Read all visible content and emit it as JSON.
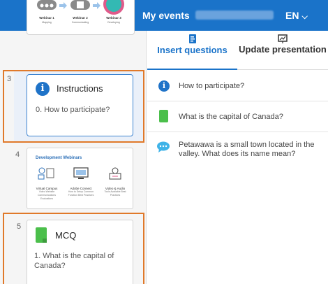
{
  "topbar": {
    "my_events_label": "My events",
    "language_label": "EN"
  },
  "slides": {
    "items": [
      {
        "number": "",
        "webinar_labels": [
          "Webinar 1",
          "Webinar 2",
          "Webinar 3"
        ],
        "webinar_subs": [
          "Mapping",
          "Communicating",
          "Developing"
        ]
      },
      {
        "number": "3",
        "title": "Instructions",
        "body": "0. How to participate?"
      },
      {
        "number": "4",
        "heading": "Development Webinars",
        "columns": [
          {
            "label": "Virtual Campus",
            "sub": "Video Website Communications Evaluations"
          },
          {
            "label": "Adobe Connect",
            "sub": "How to Setup Common Function Best Practices"
          },
          {
            "label": "Video & Audio",
            "sub": "Tools Available Best Practices"
          }
        ]
      },
      {
        "number": "5",
        "title": "MCQ",
        "body": "1. What is the capital of Canada?"
      }
    ]
  },
  "tabs": {
    "insert_label": "Insert questions",
    "update_label": "Update presentation"
  },
  "questions": [
    {
      "text": "How to participate?",
      "icon": "info-icon"
    },
    {
      "text": "What is the capital of Canada?",
      "icon": "mcq-icon"
    },
    {
      "text": "Petawawa is a small town located in the valley. What does its name mean?",
      "icon": "chat-icon"
    }
  ],
  "colors": {
    "brand": "#1a73c9",
    "selection": "#e0792a",
    "mcq_green": "#4bbf4b"
  }
}
